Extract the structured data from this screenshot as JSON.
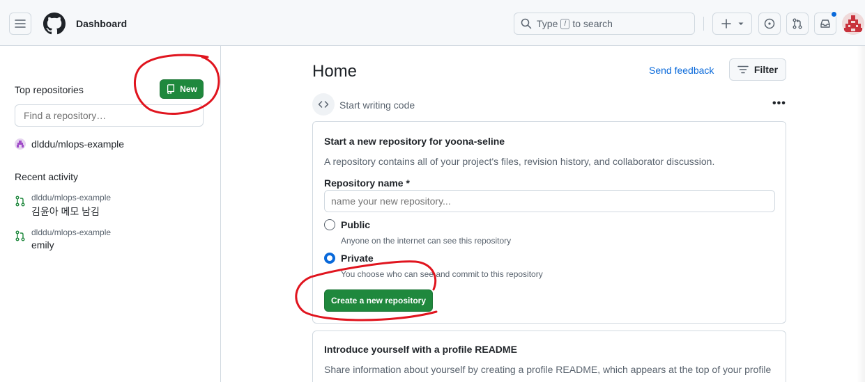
{
  "header": {
    "title": "Dashboard",
    "search": {
      "prefix": "Type",
      "key": "/",
      "suffix": "to search"
    }
  },
  "sidebar": {
    "top_repositories": "Top repositories",
    "new_button": "New",
    "find_placeholder": "Find a repository…",
    "repos": [
      "dlddu/mlops-example"
    ],
    "recent_activity": "Recent activity",
    "activity": [
      {
        "repo": "dlddu/mlops-example",
        "message": "김윤아 메모 남김"
      },
      {
        "repo": "dlddu/mlops-example",
        "message": "emily"
      }
    ]
  },
  "main": {
    "title": "Home",
    "send_feedback": "Send feedback",
    "filter": "Filter",
    "start_writing": "Start writing code",
    "new_repo_card": {
      "title": "Start a new repository for yoona-seline",
      "description": "A repository contains all of your project's files, revision history, and collaborator discussion.",
      "name_label": "Repository name *",
      "name_placeholder": "name your new repository...",
      "public_label": "Public",
      "public_note": "Anyone on the internet can see this repository",
      "private_label": "Private",
      "private_note": "You choose who can see and commit to this repository",
      "selected_visibility": "Private",
      "create_button": "Create a new repository"
    },
    "readme_card": {
      "title": "Introduce yourself with a profile README",
      "description": "Share information about yourself by creating a profile README, which appears at the top of your profile"
    }
  },
  "colors": {
    "primary_button": "#1f883d",
    "link": "#0969da",
    "annotation": "#e0141e"
  }
}
